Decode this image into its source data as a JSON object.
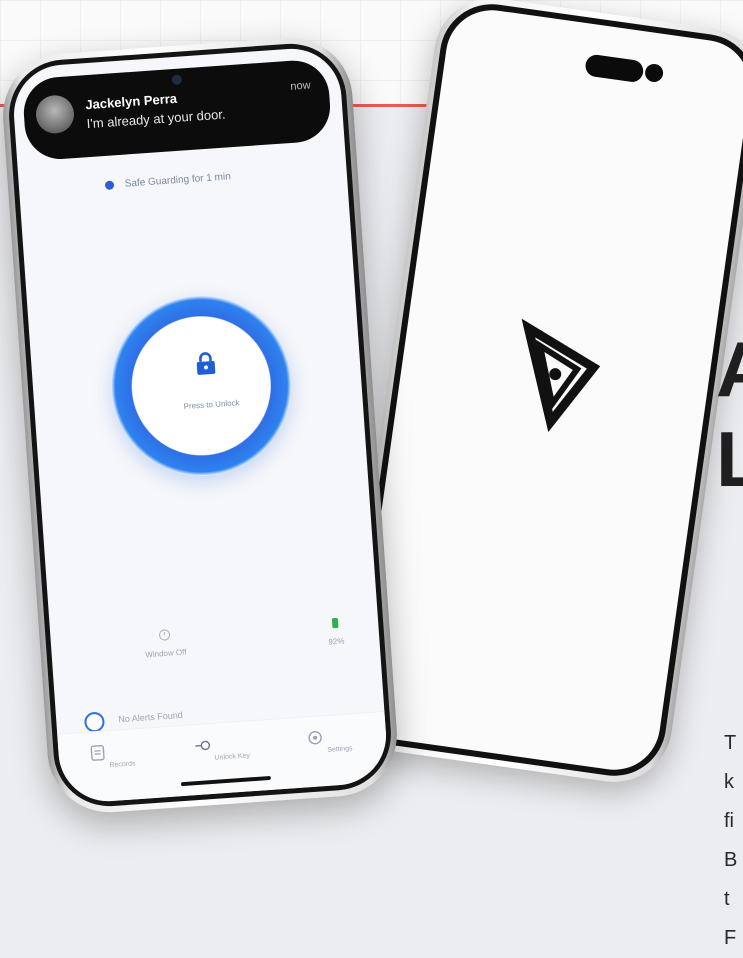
{
  "heading": {
    "line1": "A",
    "line2": "L"
  },
  "description_lines": [
    "T",
    "k",
    "fi",
    "B",
    "t",
    "F"
  ],
  "notification": {
    "name": "Jackelyn Perra",
    "message": "I'm already at your door.",
    "time": "now"
  },
  "app": {
    "status_text": "Safe Guarding for 1 min",
    "unlock_label": "Press to Unlock",
    "widgets": [
      {
        "label": "Window Off"
      },
      {
        "label": "92%"
      }
    ],
    "alert_row": "No Alerts Found"
  },
  "tabs": [
    "Records",
    "Unlock Key",
    "Settings"
  ],
  "colors": {
    "accent": "#2f6fe5",
    "red": "#e8604c",
    "dark": "#111111"
  }
}
